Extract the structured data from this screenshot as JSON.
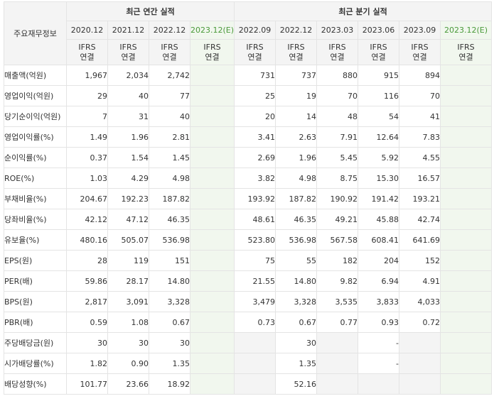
{
  "header": {
    "item_label": "주요재무정보",
    "annual_group": "최근 연간 실적",
    "quarter_group": "최근 분기 실적"
  },
  "columns": [
    {
      "date": "2020.12",
      "std1": "IFRS",
      "std2": "연결",
      "estimate": false
    },
    {
      "date": "2021.12",
      "std1": "IFRS",
      "std2": "연결",
      "estimate": false
    },
    {
      "date": "2022.12",
      "std1": "IFRS",
      "std2": "연결",
      "estimate": false
    },
    {
      "date": "2023.12(E)",
      "std1": "IFRS",
      "std2": "연결",
      "estimate": true
    },
    {
      "date": "2022.09",
      "std1": "IFRS",
      "std2": "연결",
      "estimate": false
    },
    {
      "date": "2022.12",
      "std1": "IFRS",
      "std2": "연결",
      "estimate": false
    },
    {
      "date": "2023.03",
      "std1": "IFRS",
      "std2": "연결",
      "estimate": false
    },
    {
      "date": "2023.06",
      "std1": "IFRS",
      "std2": "연결",
      "estimate": false
    },
    {
      "date": "2023.09",
      "std1": "IFRS",
      "std2": "연결",
      "estimate": false
    },
    {
      "date": "2023.12(E)",
      "std1": "IFRS",
      "std2": "연결",
      "estimate": true
    }
  ],
  "rows": [
    {
      "label": "매출액(억원)",
      "group_start": false,
      "values": [
        "1,967",
        "2,034",
        "2,742",
        "",
        "731",
        "737",
        "880",
        "915",
        "894",
        ""
      ]
    },
    {
      "label": "영업이익(억원)",
      "group_start": false,
      "values": [
        "29",
        "40",
        "77",
        "",
        "25",
        "19",
        "70",
        "116",
        "70",
        ""
      ]
    },
    {
      "label": "당기순이익(억원)",
      "group_start": false,
      "values": [
        "7",
        "31",
        "40",
        "",
        "20",
        "14",
        "48",
        "54",
        "41",
        ""
      ]
    },
    {
      "label": "영업이익률(%)",
      "group_start": true,
      "values": [
        "1.49",
        "1.96",
        "2.81",
        "",
        "3.41",
        "2.63",
        "7.91",
        "12.64",
        "7.83",
        ""
      ]
    },
    {
      "label": "순이익률(%)",
      "group_start": false,
      "values": [
        "0.37",
        "1.54",
        "1.45",
        "",
        "2.69",
        "1.96",
        "5.45",
        "5.92",
        "4.55",
        ""
      ]
    },
    {
      "label": "ROE(%)",
      "group_start": false,
      "values": [
        "1.03",
        "4.29",
        "4.98",
        "",
        "3.82",
        "4.98",
        "8.75",
        "15.30",
        "16.57",
        ""
      ]
    },
    {
      "label": "부채비율(%)",
      "group_start": true,
      "values": [
        "204.67",
        "192.23",
        "187.82",
        "",
        "193.92",
        "187.82",
        "190.92",
        "191.42",
        "193.21",
        ""
      ]
    },
    {
      "label": "당좌비율(%)",
      "group_start": false,
      "values": [
        "42.12",
        "47.12",
        "46.35",
        "",
        "48.61",
        "46.35",
        "49.21",
        "45.88",
        "42.74",
        ""
      ]
    },
    {
      "label": "유보율(%)",
      "group_start": false,
      "values": [
        "480.16",
        "505.07",
        "536.98",
        "",
        "523.80",
        "536.98",
        "567.58",
        "608.41",
        "641.69",
        ""
      ]
    },
    {
      "label": "EPS(원)",
      "group_start": true,
      "values": [
        "28",
        "119",
        "151",
        "",
        "75",
        "55",
        "182",
        "204",
        "152",
        ""
      ]
    },
    {
      "label": "PER(배)",
      "group_start": false,
      "values": [
        "59.86",
        "28.17",
        "14.80",
        "",
        "21.55",
        "14.80",
        "9.82",
        "6.94",
        "4.91",
        ""
      ]
    },
    {
      "label": "BPS(원)",
      "group_start": false,
      "values": [
        "2,817",
        "3,091",
        "3,328",
        "",
        "3,479",
        "3,328",
        "3,535",
        "3,833",
        "4,033",
        ""
      ]
    },
    {
      "label": "PBR(배)",
      "group_start": false,
      "values": [
        "0.59",
        "1.08",
        "0.67",
        "",
        "0.73",
        "0.67",
        "0.77",
        "0.93",
        "0.72",
        ""
      ]
    },
    {
      "label": "주당배당금(원)",
      "group_start": true,
      "values": [
        "30",
        "30",
        "30",
        "",
        "",
        "30",
        "",
        "-",
        "",
        ""
      ]
    },
    {
      "label": "시가배당률(%)",
      "group_start": false,
      "values": [
        "1.82",
        "0.90",
        "1.35",
        "",
        "",
        "1.35",
        "",
        "-",
        "",
        ""
      ]
    },
    {
      "label": "배당성향(%)",
      "group_start": false,
      "values": [
        "101.77",
        "23.66",
        "18.92",
        "",
        "",
        "52.16",
        "",
        "",
        "",
        ""
      ]
    }
  ],
  "colors": {
    "header_bg": "#f4f4f4",
    "estimate_bg": "#f1f7ee",
    "estimate_date": "#4a9a3a",
    "ifrs_text": "#ee6633",
    "border": "#e4e4e4"
  }
}
